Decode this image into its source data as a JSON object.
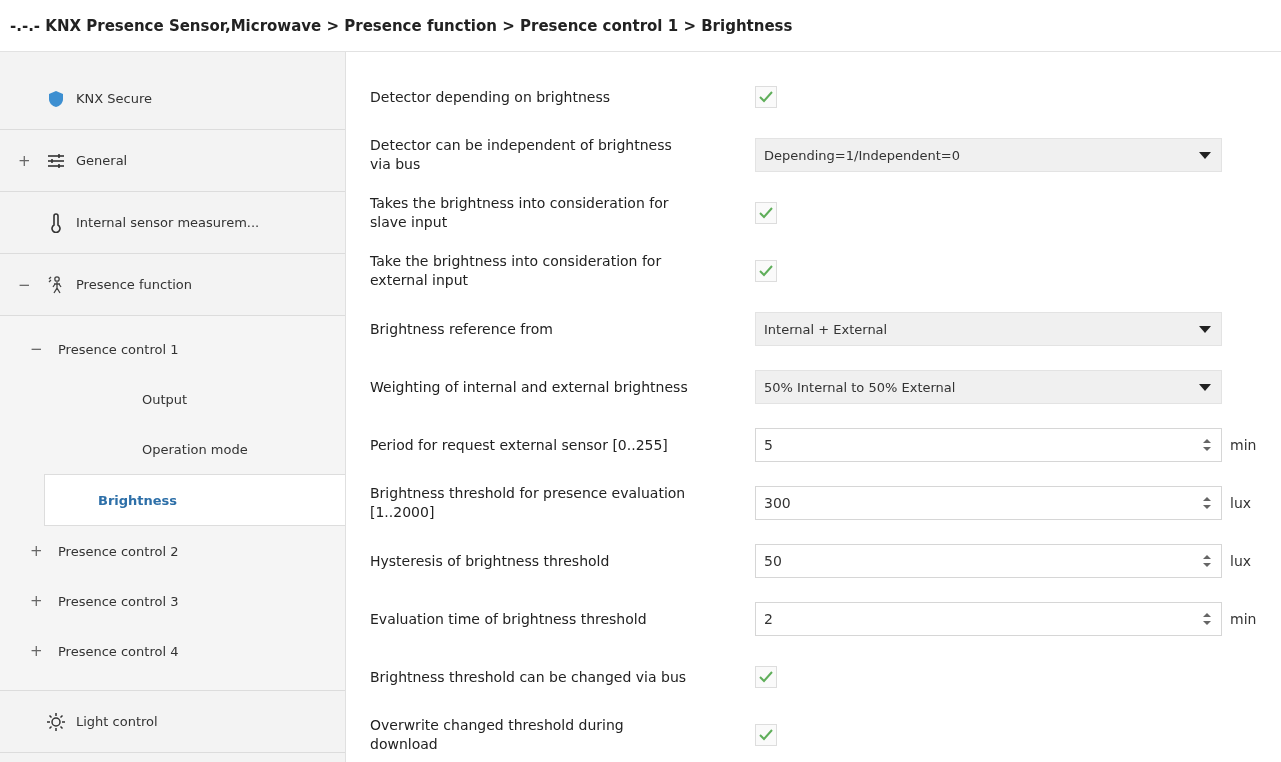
{
  "window": {
    "title": "-.-.- KNX Presence Sensor,Microwave > Presence function > Presence control 1 > Brightness"
  },
  "sidebar": {
    "items": [
      {
        "label": "KNX Secure",
        "selected": false
      },
      {
        "label": "General",
        "expander": "+",
        "selected": false
      },
      {
        "label": "Internal sensor measurem...",
        "selected": false
      },
      {
        "label": "Presence function",
        "expander": "−",
        "selected": false,
        "children": [
          {
            "label": "Presence control 1",
            "expander": "−",
            "selected": false,
            "children": [
              {
                "label": "Output",
                "selected": false
              },
              {
                "label": "Operation mode",
                "selected": false
              },
              {
                "label": "Brightness",
                "selected": true
              }
            ]
          },
          {
            "label": "Presence control 2",
            "expander": "+",
            "selected": false
          },
          {
            "label": "Presence control 3",
            "expander": "+",
            "selected": false
          },
          {
            "label": "Presence control 4",
            "expander": "+",
            "selected": false
          }
        ]
      },
      {
        "label": "Light control",
        "selected": false
      }
    ]
  },
  "parameters": [
    {
      "kind": "checkbox",
      "label": "Detector depending on brightness",
      "checked": true
    },
    {
      "kind": "select",
      "label": "Detector can be independent of brightness via bus",
      "value": "Depending=1/Independent=0"
    },
    {
      "kind": "checkbox",
      "label": "Takes the brightness into consideration for slave input",
      "checked": true
    },
    {
      "kind": "checkbox",
      "label": "Take the brightness into consideration for external input",
      "checked": true
    },
    {
      "kind": "select",
      "label": "Brightness reference from",
      "value": "Internal + External"
    },
    {
      "kind": "select",
      "label": "Weighting of internal and external brightness",
      "value": "50% Internal to 50% External"
    },
    {
      "kind": "number",
      "label": "Period for request external sensor [0..255]",
      "value": "5",
      "unit": "min"
    },
    {
      "kind": "number",
      "label": "Brightness threshold for presence evaluation [1..2000]",
      "value": "300",
      "unit": "lux"
    },
    {
      "kind": "number",
      "label": "Hysteresis of brightness threshold",
      "value": "50",
      "unit": "lux"
    },
    {
      "kind": "number",
      "label": "Evaluation time of brightness threshold",
      "value": "2",
      "unit": "min"
    },
    {
      "kind": "checkbox",
      "label": "Brightness threshold can be changed via bus",
      "checked": true
    },
    {
      "kind": "checkbox",
      "label": "Overwrite changed threshold during download",
      "checked": true
    }
  ]
}
